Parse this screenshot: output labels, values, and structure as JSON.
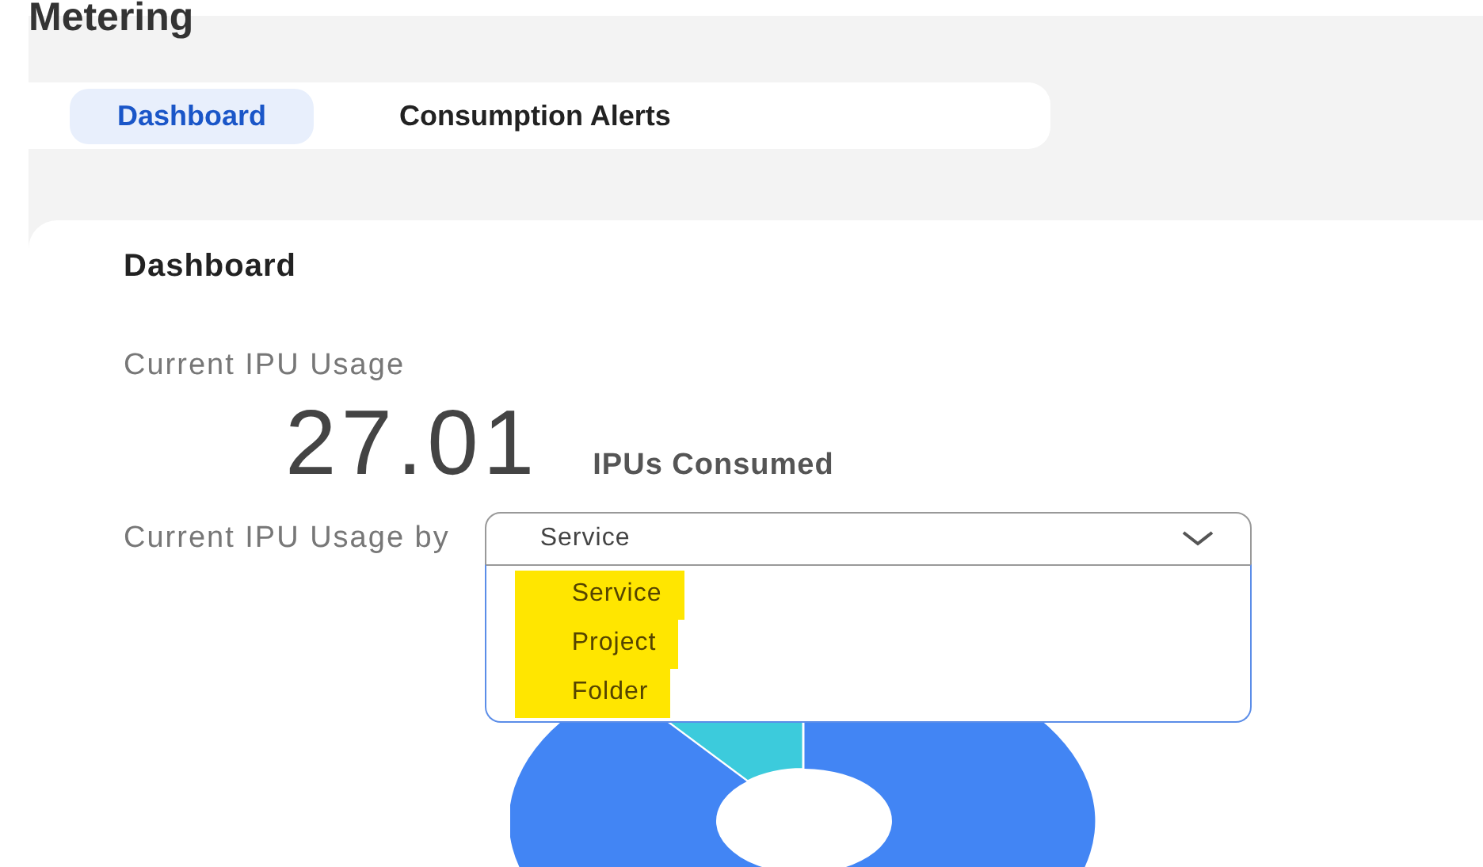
{
  "page_title": "Metering",
  "tabs": [
    {
      "label": "Dashboard",
      "selected": true
    },
    {
      "label": "Consumption Alerts",
      "selected": false
    }
  ],
  "card": {
    "title": "Dashboard",
    "usage_label": "Current IPU Usage",
    "usage_value": "27.01",
    "usage_unit": "IPUs Consumed",
    "group_by_label": "Current IPU Usage by",
    "dropdown": {
      "value": "Service",
      "expanded": true,
      "options": [
        {
          "label": "Service",
          "highlighted": true
        },
        {
          "label": "Project",
          "highlighted": true
        },
        {
          "label": "Folder",
          "highlighted": true
        }
      ]
    }
  }
}
